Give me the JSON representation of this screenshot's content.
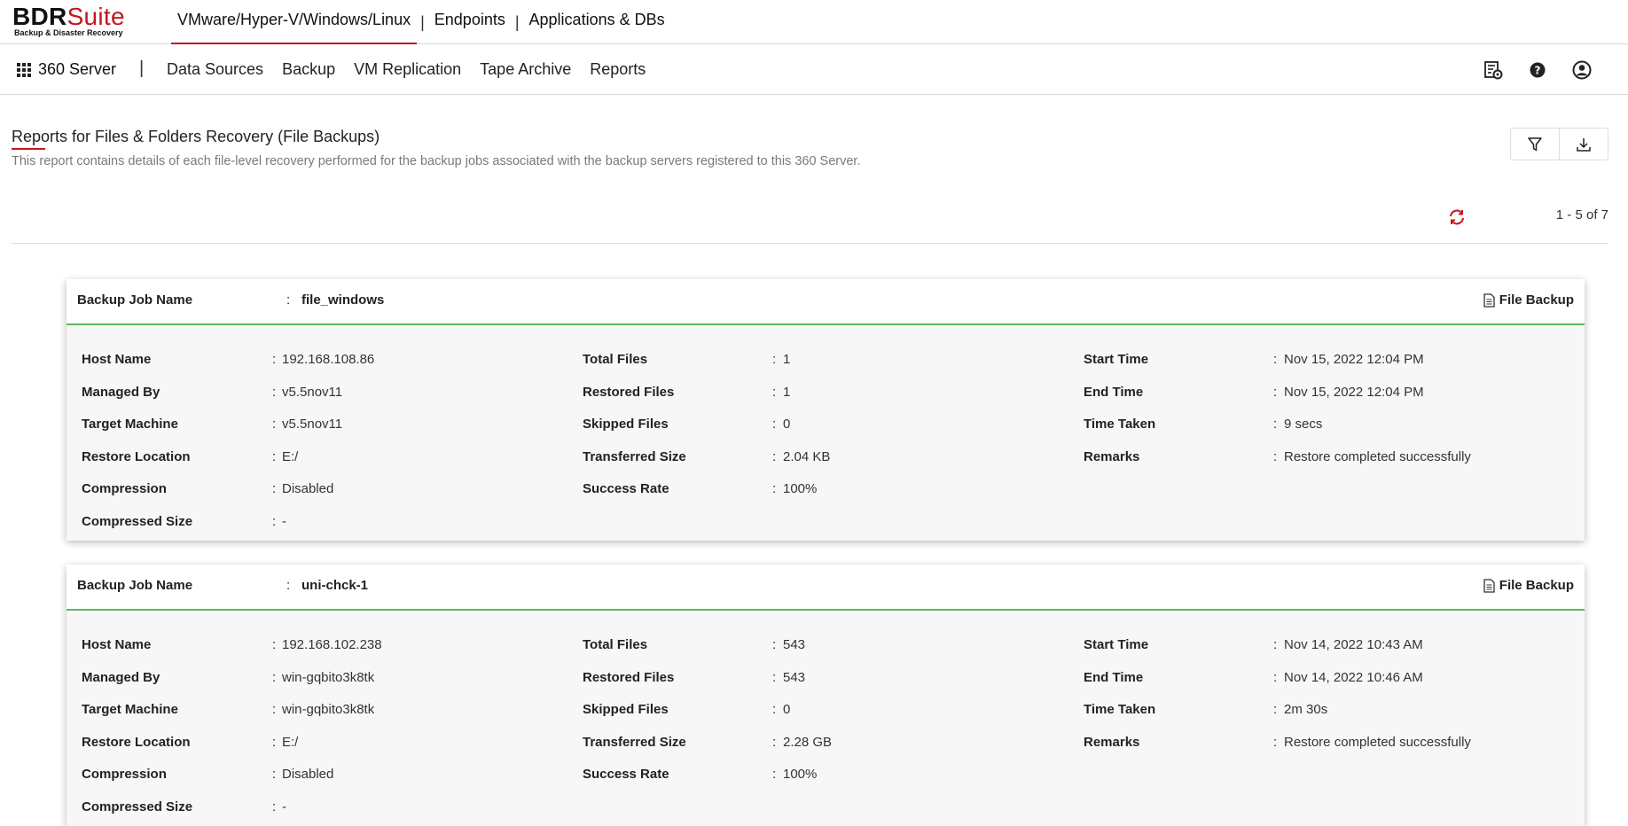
{
  "logo": {
    "main_a": "BDR",
    "main_b": "Suite",
    "sub": "Backup & Disaster Recovery"
  },
  "product_tabs": [
    {
      "label": "VMware/Hyper-V/Windows/Linux"
    },
    {
      "label": "Endpoints"
    },
    {
      "label": "Applications & DBs"
    }
  ],
  "subnav": {
    "server": "360 Server",
    "separator": "|",
    "items": [
      "Data Sources",
      "Backup",
      "VM Replication",
      "Tape Archive",
      "Reports"
    ]
  },
  "page": {
    "title": "Reports for Files & Folders Recovery (File Backups)",
    "description": "This report contains details of each file-level recovery performed for the backup jobs associated with the backup servers registered to this 360 Server.",
    "pager": "1 - 5 of 7"
  },
  "labels": {
    "job_name": "Backup Job Name",
    "host_name": "Host Name",
    "managed_by": "Managed By",
    "target_machine": "Target Machine",
    "restore_location": "Restore Location",
    "compression": "Compression",
    "compressed_size": "Compressed Size",
    "total_files": "Total Files",
    "restored_files": "Restored Files",
    "skipped_files": "Skipped Files",
    "transferred_size": "Transferred Size",
    "success_rate": "Success Rate",
    "start_time": "Start Time",
    "end_time": "End Time",
    "time_taken": "Time Taken",
    "remarks": "Remarks",
    "colon": ":"
  },
  "cards": [
    {
      "job_name": "file_windows",
      "type": "File Backup",
      "host_name": "192.168.108.86",
      "managed_by": "v5.5nov11",
      "target_machine": "v5.5nov11",
      "restore_location": "E:/",
      "compression": "Disabled",
      "compressed_size": "-",
      "total_files": "1",
      "restored_files": "1",
      "skipped_files": "0",
      "transferred_size": "2.04 KB",
      "success_rate": "100%",
      "start_time": "Nov 15, 2022 12:04 PM",
      "end_time": "Nov 15, 2022 12:04 PM",
      "time_taken": "9 secs",
      "remarks": "Restore completed successfully"
    },
    {
      "job_name": "uni-chck-1",
      "type": "File Backup",
      "host_name": "192.168.102.238",
      "managed_by": "win-gqbito3k8tk",
      "target_machine": "win-gqbito3k8tk",
      "restore_location": "E:/",
      "compression": "Disabled",
      "compressed_size": "-",
      "total_files": "543",
      "restored_files": "543",
      "skipped_files": "0",
      "transferred_size": "2.28 GB",
      "success_rate": "100%",
      "start_time": "Nov 14, 2022 10:43 AM",
      "end_time": "Nov 14, 2022 10:46 AM",
      "time_taken": "2m 30s",
      "remarks": "Restore completed successfully"
    }
  ],
  "colors": {
    "accent": "#c4161c",
    "success_line": "#5cb85c"
  },
  "icons": {
    "settings": "report-settings-icon",
    "help": "help-icon",
    "user": "user-icon",
    "filter": "filter-icon",
    "download": "download-icon",
    "refresh": "refresh-icon",
    "file": "document-icon"
  }
}
